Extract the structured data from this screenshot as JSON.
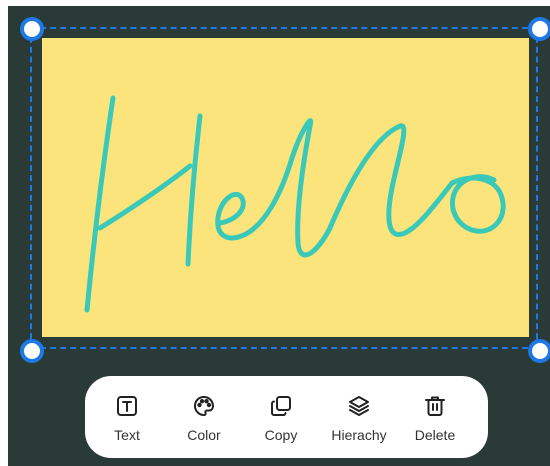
{
  "canvas": {
    "background_color": "#2a3a36",
    "note_color": "#fbe47c",
    "ink_color": "#3ac9b8",
    "selection_color": "#1e78e6",
    "handwriting_text": "Hello"
  },
  "toolbar": {
    "items": [
      {
        "label": "Text",
        "icon": "text-icon"
      },
      {
        "label": "Color",
        "icon": "palette-icon"
      },
      {
        "label": "Copy",
        "icon": "copy-icon"
      },
      {
        "label": "Hierachy",
        "icon": "layers-icon"
      },
      {
        "label": "Delete",
        "icon": "trash-icon"
      }
    ]
  }
}
